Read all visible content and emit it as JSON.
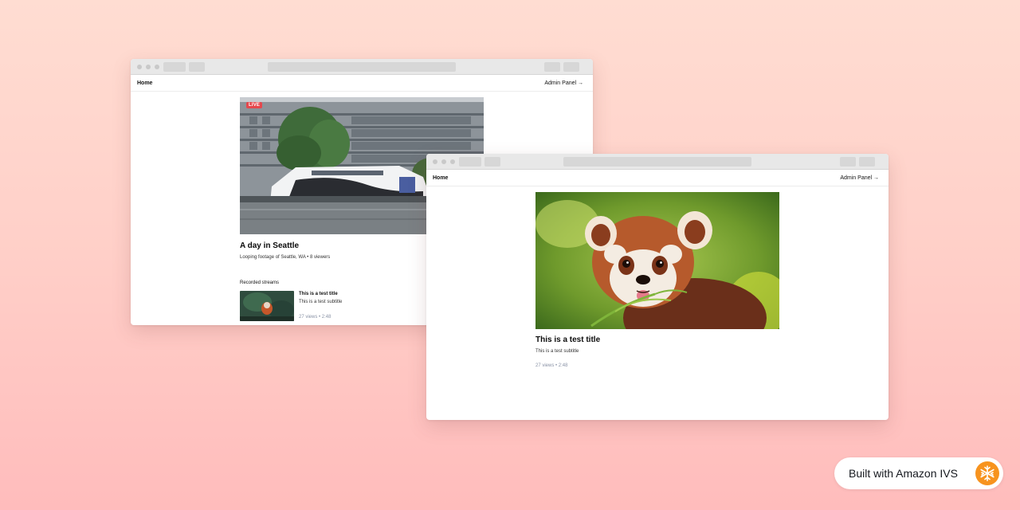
{
  "colors": {
    "background_top": "#ffddd2",
    "background_bottom": "#ffbcbc",
    "live_badge": "#e5484d",
    "meta_text": "#8a93a6",
    "ivs_orange": "#f7931e"
  },
  "back_window": {
    "nav": {
      "home": "Home",
      "admin": "Admin Panel →"
    },
    "live_badge": "LIVE",
    "stream": {
      "title": "A day in Seattle",
      "subtitle": "Looping footage of Seattle, WA • 8 viewers"
    },
    "recorded": {
      "heading": "Recorded streams",
      "items": [
        {
          "title": "This is a test title",
          "subtitle": "This is a test subtitle",
          "meta": "27 views • 2:48"
        }
      ]
    }
  },
  "front_window": {
    "nav": {
      "home": "Home",
      "admin": "Admin Panel →"
    },
    "video": {
      "title": "This is a test title",
      "subtitle": "This is a test subtitle",
      "meta": "27 views • 2:48"
    }
  },
  "badge": {
    "text": "Built with Amazon IVS",
    "icon": "amazon-ivs-logo-icon"
  }
}
